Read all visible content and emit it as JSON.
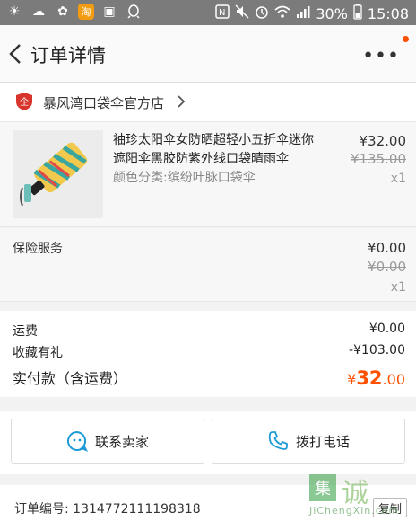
{
  "status_bar": {
    "battery": "30%",
    "time": "15:08",
    "icons": [
      "weather-icon",
      "cloud-icon",
      "flower-icon",
      "taobao-app-icon",
      "image-icon",
      "qq-icon",
      "nfc-icon",
      "mute-icon",
      "alarm-icon",
      "wifi-icon",
      "signal-icon",
      "battery-icon"
    ]
  },
  "nav": {
    "title": "订单详情",
    "more_label": "•••"
  },
  "shop": {
    "name": "暴风湾口袋伞官方店"
  },
  "product": {
    "title": "袖珍太阳伞女防晒超轻小五折伞迷你遮阳伞黑胶防紫外线口袋晴雨伞",
    "attribute": "颜色分类:缤纷叶脉口袋伞",
    "price": "¥32.00",
    "original_price": "¥135.00",
    "quantity": "x1"
  },
  "insurance": {
    "label": "保险服务",
    "price": "¥0.00",
    "original_price": "¥0.00",
    "quantity": "x1"
  },
  "summary": {
    "shipping_label": "运费",
    "shipping_value": "¥0.00",
    "favorite_gift_label": "收藏有礼",
    "favorite_gift_value": "-¥103.00",
    "total_label": "实付款（含运费）",
    "total_currency": "¥",
    "total_int": "32",
    "total_dec": ".00"
  },
  "actions": {
    "contact_seller": "联系卖家",
    "call_phone": "拨打电话"
  },
  "order": {
    "number_text": "订单编号: 1314772111198318",
    "copy_label": "复制"
  },
  "watermark": {
    "char": "集",
    "big": "诚",
    "small": "JiChengXin.com"
  },
  "colors": {
    "accent": "#ff5000",
    "statusbar": "#7b7b7b"
  }
}
